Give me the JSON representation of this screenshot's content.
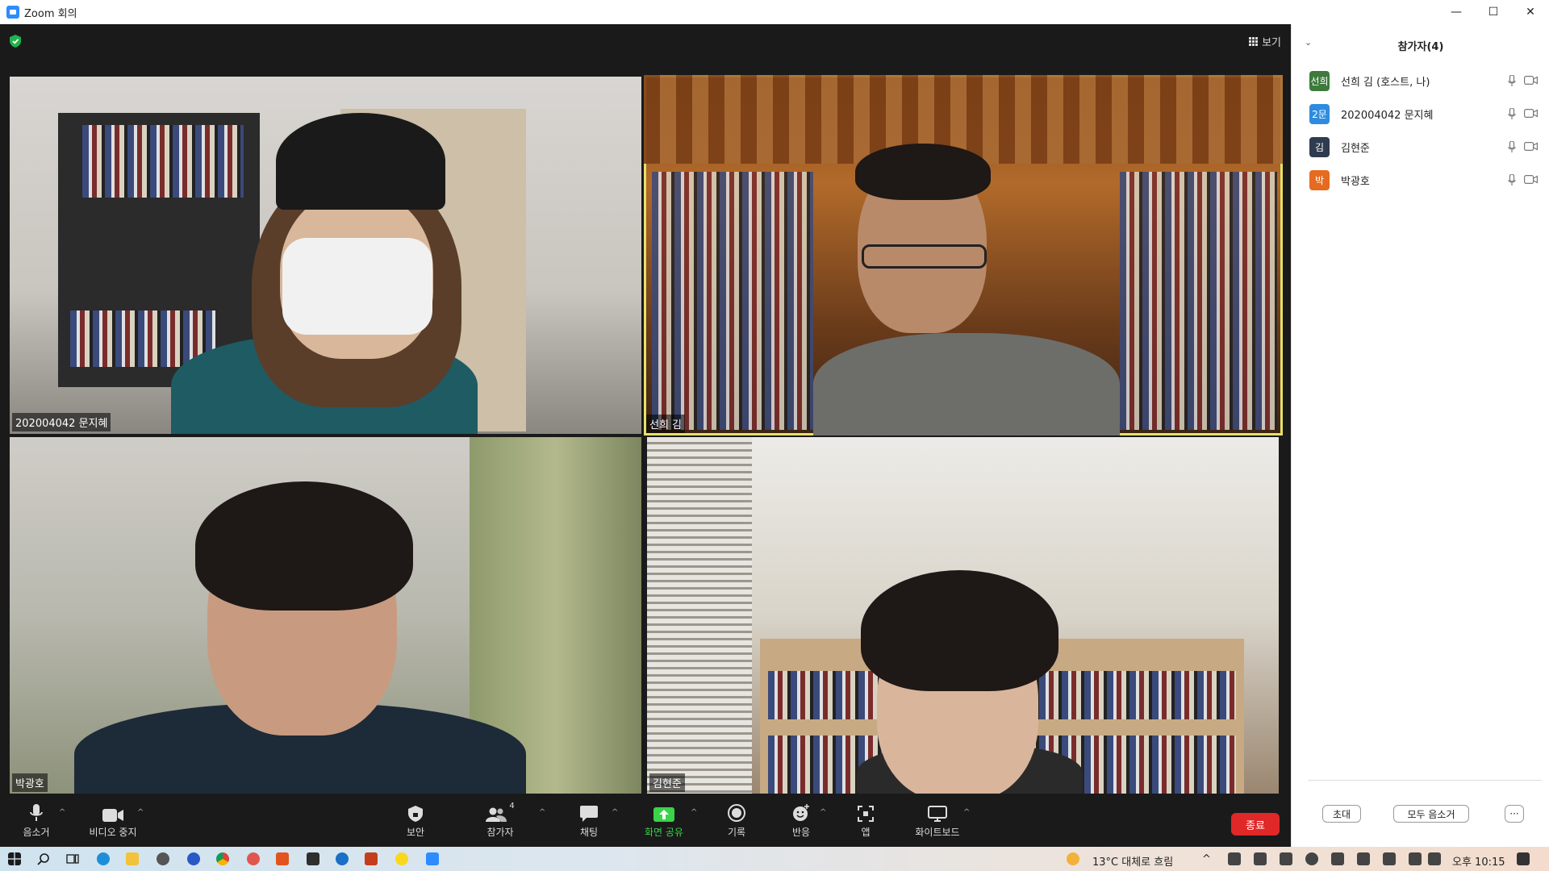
{
  "window": {
    "title": "Zoom 회의",
    "controls": [
      "—",
      "☐",
      "✕"
    ]
  },
  "view_button": {
    "label": "보기"
  },
  "tiles": [
    {
      "name": "202004042 문지혜"
    },
    {
      "name": "선희 김"
    },
    {
      "name": "박광호"
    },
    {
      "name": "김현준"
    }
  ],
  "toolbar": {
    "mute": "음소거",
    "video": "비디오 중지",
    "security": "보안",
    "participants": "참가자",
    "participants_count": "4",
    "chat": "채팅",
    "share": "화면 공유",
    "record": "기록",
    "reactions": "반응",
    "apps": "앱",
    "whiteboard": "화이트보드",
    "end": "종료",
    "caret": "^"
  },
  "panel": {
    "title": "참가자(4)",
    "participants": [
      {
        "avatar": "선희",
        "avatar_color": "#3d7a3b",
        "name": "선희 김 (호스트, 나)"
      },
      {
        "avatar": "2문",
        "avatar_color": "#2d8cdf",
        "name": "202004042 문지혜"
      },
      {
        "avatar": "김",
        "avatar_color": "#2f3b4e",
        "name": "김현준"
      },
      {
        "avatar": "박",
        "avatar_color": "#e66a1f",
        "name": "박광호"
      }
    ],
    "invite": "초대",
    "mute_all": "모두 음소거",
    "more": "···"
  },
  "taskbar": {
    "weather": "13°C 대체로 흐림",
    "time": "오후 10:15"
  },
  "colors": {
    "active_speaker": "#e6e06a",
    "end_button": "#e02828",
    "share_green": "#3ad34a"
  }
}
